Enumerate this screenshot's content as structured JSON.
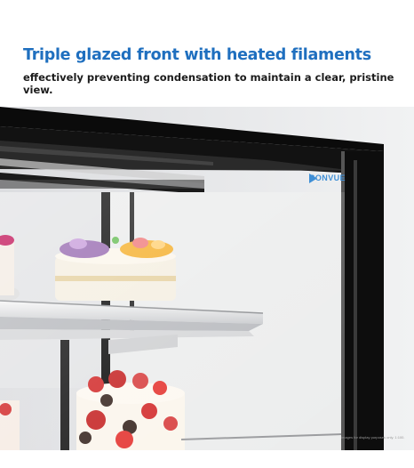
{
  "header": {
    "title": "Triple glazed front with heated filaments",
    "subtitle": "effectively preventing condensation to maintain a clear, pristine view."
  },
  "photo": {
    "brand_logo": "BONVUE",
    "disclaimer": "Images for display purposes only. 1:100."
  },
  "colors": {
    "title": "#1f6fbf",
    "cabinet_frame": "#0d0d0d",
    "background": "#e9eaec",
    "logo": "#3f8fd6"
  }
}
